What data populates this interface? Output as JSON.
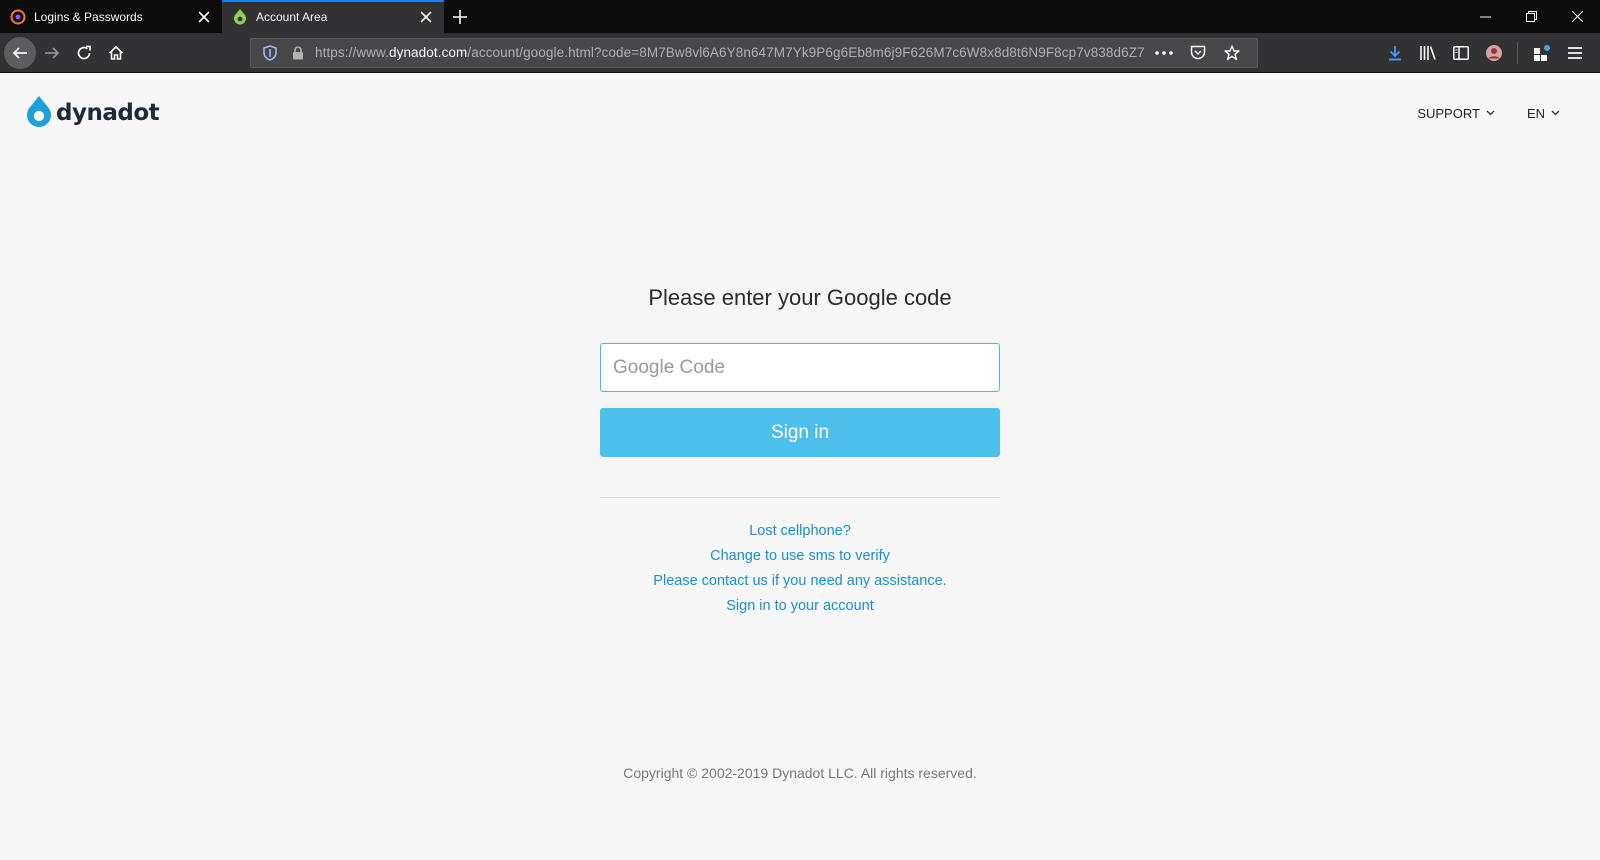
{
  "browser": {
    "tabs": [
      {
        "title": "Logins & Passwords",
        "active": false
      },
      {
        "title": "Account Area",
        "active": true
      }
    ],
    "url": {
      "prefix": "https://www.",
      "domain": "dynadot.com",
      "path": "/account/google.html?code=8M7Bw8vl6A6Y8n647M7Yk9P6g6Eb8m6j9F626M7c6W8x8d8t6N9F8cp7v838d6Z7"
    }
  },
  "site": {
    "logo": "dynadot",
    "support_label": "SUPPORT",
    "language_label": "EN"
  },
  "form": {
    "heading": "Please enter your Google code",
    "input_placeholder": "Google Code",
    "input_value": "",
    "submit_label": "Sign in"
  },
  "links": {
    "lost_phone": "Lost cellphone?",
    "use_sms": "Change to use sms to verify",
    "contact": "Please contact us if you need any assistance.",
    "sign_in_account": "Sign in to your account"
  },
  "footer": {
    "copyright": "Copyright © 2002-2019 Dynadot LLC. All rights reserved."
  },
  "colors": {
    "accent": "#4dbfeb",
    "link": "#1a8fce",
    "logo_blue": "#1d9fdb"
  }
}
